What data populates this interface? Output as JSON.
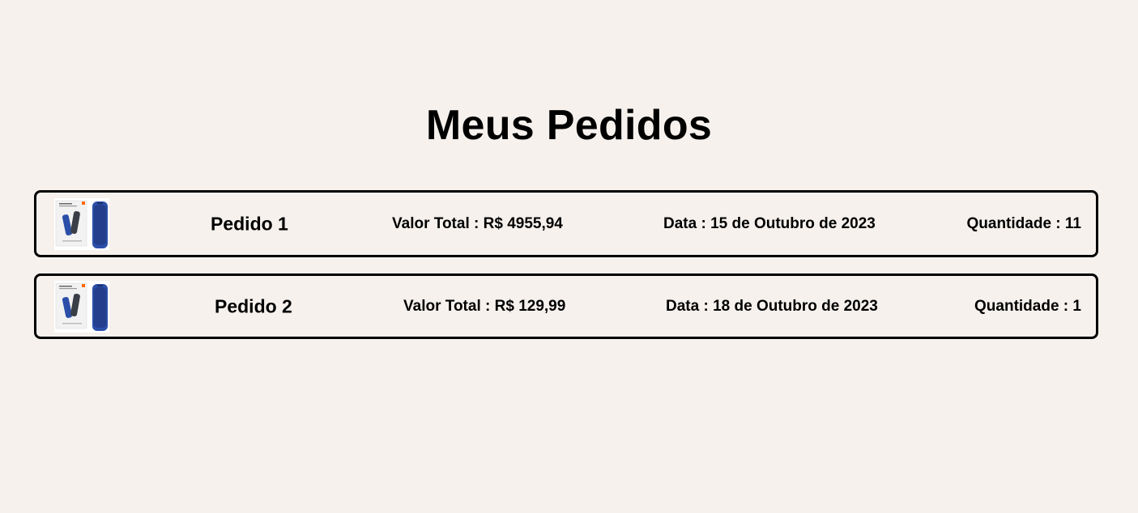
{
  "page": {
    "title": "Meus Pedidos"
  },
  "orders": [
    {
      "name": "Pedido 1",
      "total_label": "Valor Total :",
      "total_value": "R$ 4955,94",
      "date_label": "Data :",
      "date_value": "15 de Outubro de 2023",
      "qty_label": "Quantidade :",
      "qty_value": "11",
      "thumbnail": "product-speaker-image"
    },
    {
      "name": "Pedido 2",
      "total_label": "Valor Total :",
      "total_value": "R$ 129,99",
      "date_label": "Data :",
      "date_value": "18 de Outubro de 2023",
      "qty_label": "Quantidade :",
      "qty_value": "1",
      "thumbnail": "product-speaker-image"
    }
  ],
  "colors": {
    "background": "#f6f1ed",
    "border": "#000000",
    "text": "#000000",
    "product_blue": "#2b4fa8"
  }
}
